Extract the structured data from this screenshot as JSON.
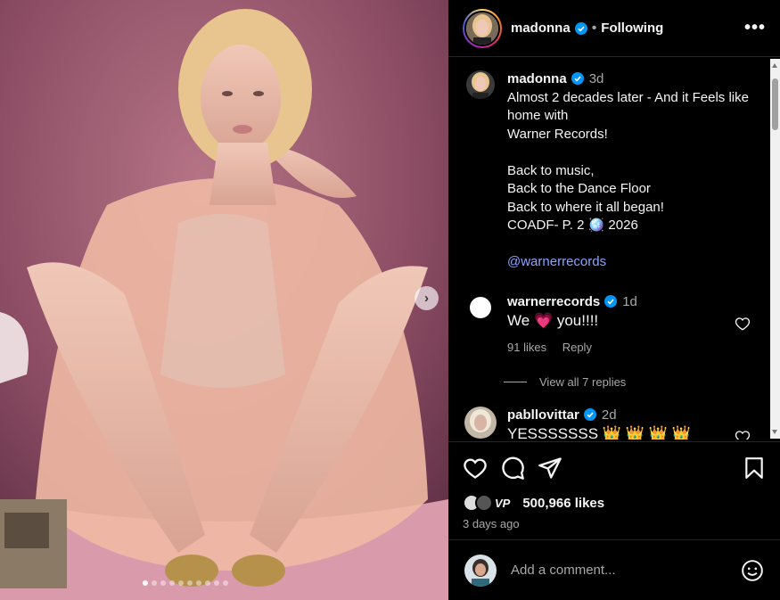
{
  "header": {
    "username": "madonna",
    "separator": "•",
    "follow_status": "Following",
    "more_glyph": "•••"
  },
  "caption": {
    "username": "madonna",
    "time": "3d",
    "text": "Almost 2 decades later - And it Feels like  home with\nWarner Records!\n\nBack to music,\nBack to the Dance Floor\nBack to where it all began!\nCOADF- P. 2 🪩 2026",
    "mention": "@warnerrecords"
  },
  "comments": [
    {
      "username": "warnerrecords",
      "time": "1d",
      "text_before": "We",
      "emoji": "💗",
      "text_after": "you!!!!",
      "likes": "91 likes",
      "reply_label": "Reply",
      "view_replies": "View all 7 replies"
    },
    {
      "username": "pabllovittar",
      "time": "2d",
      "text": "YESSSSSSS 👑 👑 👑 👑"
    }
  ],
  "actions": {
    "like_icon": "heart-outline-icon",
    "comment_icon": "comment-bubble-icon",
    "share_icon": "paper-plane-icon",
    "save_icon": "bookmark-icon"
  },
  "likes": {
    "count": "500,966 likes",
    "badge": "VP"
  },
  "posted": "3 days ago",
  "add_comment": {
    "placeholder": "Add a comment...",
    "emoji_icon": "smiley-icon"
  },
  "carousel": {
    "total_slides": 10,
    "active_index": 0,
    "next_glyph": "›"
  },
  "colors": {
    "background": "#000000",
    "verified": "#0095f6",
    "mention": "#8da3ff",
    "secondary_text": "#a8a8a8"
  }
}
